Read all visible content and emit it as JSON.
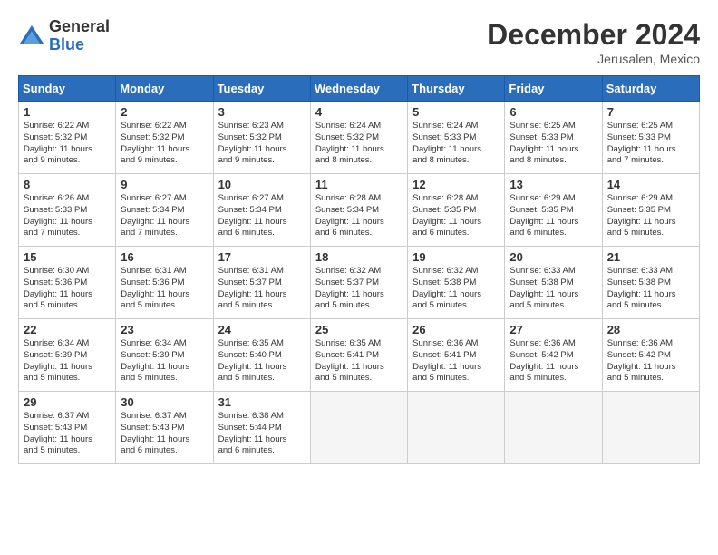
{
  "header": {
    "logo_general": "General",
    "logo_blue": "Blue",
    "month_title": "December 2024",
    "location": "Jerusalen, Mexico"
  },
  "days_of_week": [
    "Sunday",
    "Monday",
    "Tuesday",
    "Wednesday",
    "Thursday",
    "Friday",
    "Saturday"
  ],
  "weeks": [
    [
      {
        "day": "1",
        "lines": [
          "Sunrise: 6:22 AM",
          "Sunset: 5:32 PM",
          "Daylight: 11 hours",
          "and 9 minutes."
        ]
      },
      {
        "day": "2",
        "lines": [
          "Sunrise: 6:22 AM",
          "Sunset: 5:32 PM",
          "Daylight: 11 hours",
          "and 9 minutes."
        ]
      },
      {
        "day": "3",
        "lines": [
          "Sunrise: 6:23 AM",
          "Sunset: 5:32 PM",
          "Daylight: 11 hours",
          "and 9 minutes."
        ]
      },
      {
        "day": "4",
        "lines": [
          "Sunrise: 6:24 AM",
          "Sunset: 5:32 PM",
          "Daylight: 11 hours",
          "and 8 minutes."
        ]
      },
      {
        "day": "5",
        "lines": [
          "Sunrise: 6:24 AM",
          "Sunset: 5:33 PM",
          "Daylight: 11 hours",
          "and 8 minutes."
        ]
      },
      {
        "day": "6",
        "lines": [
          "Sunrise: 6:25 AM",
          "Sunset: 5:33 PM",
          "Daylight: 11 hours",
          "and 8 minutes."
        ]
      },
      {
        "day": "7",
        "lines": [
          "Sunrise: 6:25 AM",
          "Sunset: 5:33 PM",
          "Daylight: 11 hours",
          "and 7 minutes."
        ]
      }
    ],
    [
      {
        "day": "8",
        "lines": [
          "Sunrise: 6:26 AM",
          "Sunset: 5:33 PM",
          "Daylight: 11 hours",
          "and 7 minutes."
        ]
      },
      {
        "day": "9",
        "lines": [
          "Sunrise: 6:27 AM",
          "Sunset: 5:34 PM",
          "Daylight: 11 hours",
          "and 7 minutes."
        ]
      },
      {
        "day": "10",
        "lines": [
          "Sunrise: 6:27 AM",
          "Sunset: 5:34 PM",
          "Daylight: 11 hours",
          "and 6 minutes."
        ]
      },
      {
        "day": "11",
        "lines": [
          "Sunrise: 6:28 AM",
          "Sunset: 5:34 PM",
          "Daylight: 11 hours",
          "and 6 minutes."
        ]
      },
      {
        "day": "12",
        "lines": [
          "Sunrise: 6:28 AM",
          "Sunset: 5:35 PM",
          "Daylight: 11 hours",
          "and 6 minutes."
        ]
      },
      {
        "day": "13",
        "lines": [
          "Sunrise: 6:29 AM",
          "Sunset: 5:35 PM",
          "Daylight: 11 hours",
          "and 6 minutes."
        ]
      },
      {
        "day": "14",
        "lines": [
          "Sunrise: 6:29 AM",
          "Sunset: 5:35 PM",
          "Daylight: 11 hours",
          "and 5 minutes."
        ]
      }
    ],
    [
      {
        "day": "15",
        "lines": [
          "Sunrise: 6:30 AM",
          "Sunset: 5:36 PM",
          "Daylight: 11 hours",
          "and 5 minutes."
        ]
      },
      {
        "day": "16",
        "lines": [
          "Sunrise: 6:31 AM",
          "Sunset: 5:36 PM",
          "Daylight: 11 hours",
          "and 5 minutes."
        ]
      },
      {
        "day": "17",
        "lines": [
          "Sunrise: 6:31 AM",
          "Sunset: 5:37 PM",
          "Daylight: 11 hours",
          "and 5 minutes."
        ]
      },
      {
        "day": "18",
        "lines": [
          "Sunrise: 6:32 AM",
          "Sunset: 5:37 PM",
          "Daylight: 11 hours",
          "and 5 minutes."
        ]
      },
      {
        "day": "19",
        "lines": [
          "Sunrise: 6:32 AM",
          "Sunset: 5:38 PM",
          "Daylight: 11 hours",
          "and 5 minutes."
        ]
      },
      {
        "day": "20",
        "lines": [
          "Sunrise: 6:33 AM",
          "Sunset: 5:38 PM",
          "Daylight: 11 hours",
          "and 5 minutes."
        ]
      },
      {
        "day": "21",
        "lines": [
          "Sunrise: 6:33 AM",
          "Sunset: 5:38 PM",
          "Daylight: 11 hours",
          "and 5 minutes."
        ]
      }
    ],
    [
      {
        "day": "22",
        "lines": [
          "Sunrise: 6:34 AM",
          "Sunset: 5:39 PM",
          "Daylight: 11 hours",
          "and 5 minutes."
        ]
      },
      {
        "day": "23",
        "lines": [
          "Sunrise: 6:34 AM",
          "Sunset: 5:39 PM",
          "Daylight: 11 hours",
          "and 5 minutes."
        ]
      },
      {
        "day": "24",
        "lines": [
          "Sunrise: 6:35 AM",
          "Sunset: 5:40 PM",
          "Daylight: 11 hours",
          "and 5 minutes."
        ]
      },
      {
        "day": "25",
        "lines": [
          "Sunrise: 6:35 AM",
          "Sunset: 5:41 PM",
          "Daylight: 11 hours",
          "and 5 minutes."
        ]
      },
      {
        "day": "26",
        "lines": [
          "Sunrise: 6:36 AM",
          "Sunset: 5:41 PM",
          "Daylight: 11 hours",
          "and 5 minutes."
        ]
      },
      {
        "day": "27",
        "lines": [
          "Sunrise: 6:36 AM",
          "Sunset: 5:42 PM",
          "Daylight: 11 hours",
          "and 5 minutes."
        ]
      },
      {
        "day": "28",
        "lines": [
          "Sunrise: 6:36 AM",
          "Sunset: 5:42 PM",
          "Daylight: 11 hours",
          "and 5 minutes."
        ]
      }
    ],
    [
      {
        "day": "29",
        "lines": [
          "Sunrise: 6:37 AM",
          "Sunset: 5:43 PM",
          "Daylight: 11 hours",
          "and 5 minutes."
        ]
      },
      {
        "day": "30",
        "lines": [
          "Sunrise: 6:37 AM",
          "Sunset: 5:43 PM",
          "Daylight: 11 hours",
          "and 6 minutes."
        ]
      },
      {
        "day": "31",
        "lines": [
          "Sunrise: 6:38 AM",
          "Sunset: 5:44 PM",
          "Daylight: 11 hours",
          "and 6 minutes."
        ]
      },
      {
        "day": "",
        "lines": []
      },
      {
        "day": "",
        "lines": []
      },
      {
        "day": "",
        "lines": []
      },
      {
        "day": "",
        "lines": []
      }
    ]
  ]
}
